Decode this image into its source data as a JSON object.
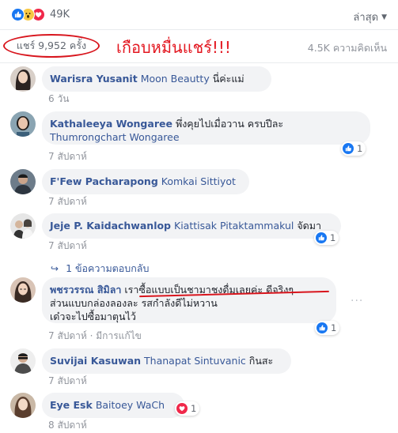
{
  "header": {
    "reaction_count": "49K",
    "sort_label": "ล่าสุด",
    "reaction_icons": [
      "like-icon",
      "wow-icon",
      "love-icon"
    ]
  },
  "stats": {
    "shares": "แชร์ 9,952 ครั้ง",
    "overlay_note": "เกือบหมื่นแชร์!!!",
    "comments": "4.5K ความคิดเห็น"
  },
  "colors": {
    "link": "#385898",
    "bubble": "#f2f3f5",
    "annotation": "#e3161f",
    "like": "#1877f2",
    "love": "#f0284a"
  },
  "comments": [
    {
      "author": "Warisra Yusanit",
      "text": "Moon Beautty นี่ค่ะแม่",
      "mention": "Moon Beautty",
      "rest": " นี่ค่ะแม่",
      "time": "6 วัน"
    },
    {
      "author": "Kathaleeya Wongaree",
      "line1": "พึ่งคุยไปเมื่อวาน ครบปีละ",
      "line2": "Thumrongchart Wongaree",
      "time": "7 สัปดาห์",
      "reactions": "1"
    },
    {
      "author": "F'Few Pacharapong",
      "mention": "Komkai Sittiyot",
      "time": "7 สัปดาห์"
    },
    {
      "author": "Jeje P. Kaidachwanlop",
      "mention": "Kiattisak Pitaktammakul",
      "rest": " จัดมา",
      "time": "7 สัปดาห์",
      "reactions": "1"
    },
    {
      "author": "พชรวรรณ สิมิลา",
      "line1": "เราซื้อแบบเป็นชามาชงดื่มเลยค่ะ ดีจริงๆ",
      "line2": "ส่วนแบบกล่องลองละ รสกำลังดีไม่หวาน",
      "line3": "เด๋วจะไปซื้อมาตุนไว้",
      "time": "7 สัปดาห์ · มีการแก้ไข",
      "reactions": "1"
    },
    {
      "author": "Suvijai Kasuwan",
      "mention": "Thanapat Sintuvanic",
      "rest": " กินสะ",
      "time": "7 สัปดาห์"
    },
    {
      "author": "Eye Esk",
      "mention": "Baitoey WaCh",
      "time": "8 สัปดาห์",
      "reactions": "1"
    }
  ],
  "replies_link": "1 ข้อความตอบกลับ"
}
